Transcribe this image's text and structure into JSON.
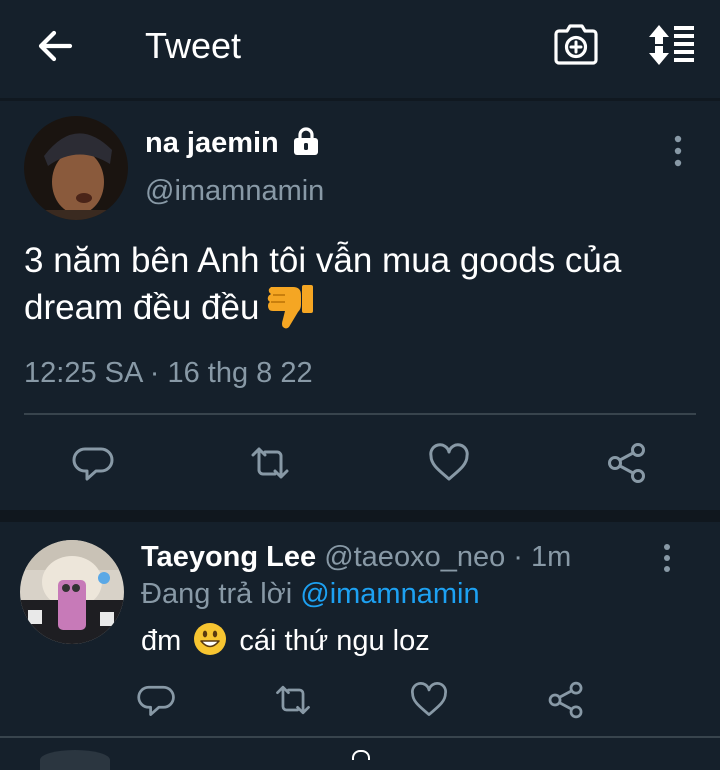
{
  "header": {
    "title": "Tweet",
    "back_icon": "arrow-left-icon",
    "camera_icon": "camera-plus-icon",
    "sort_icon": "sort-arrows-icon"
  },
  "tweet": {
    "author_name": "na jaemin",
    "author_handle": "@imamnamin",
    "protected_icon": "lock-icon",
    "text": "3 năm bên Anh tôi vẫn mua goods của dream đều đều",
    "emoji": "thumbs-down-emoji",
    "timestamp": "12:25 SA · 16 thg 8 22",
    "actions": [
      "reply-icon",
      "retweet-icon",
      "like-icon",
      "share-icon"
    ]
  },
  "reply": {
    "author_name": "Taeyong Lee",
    "author_handle": "@taeoxo_neo",
    "separator": "·",
    "time_ago": "1m",
    "replying_prefix": "Đang trả lời",
    "replying_to": "@imamnamin",
    "text_before": "đm",
    "text_after": "cái thứ ngu loz",
    "emoji": "smiling-face-emoji",
    "actions": [
      "reply-icon",
      "retweet-icon",
      "like-icon",
      "share-icon"
    ]
  },
  "colors": {
    "background": "#15202b",
    "secondary_text": "#8899a6",
    "accent": "#1da1f2",
    "divider": "#38444d"
  }
}
